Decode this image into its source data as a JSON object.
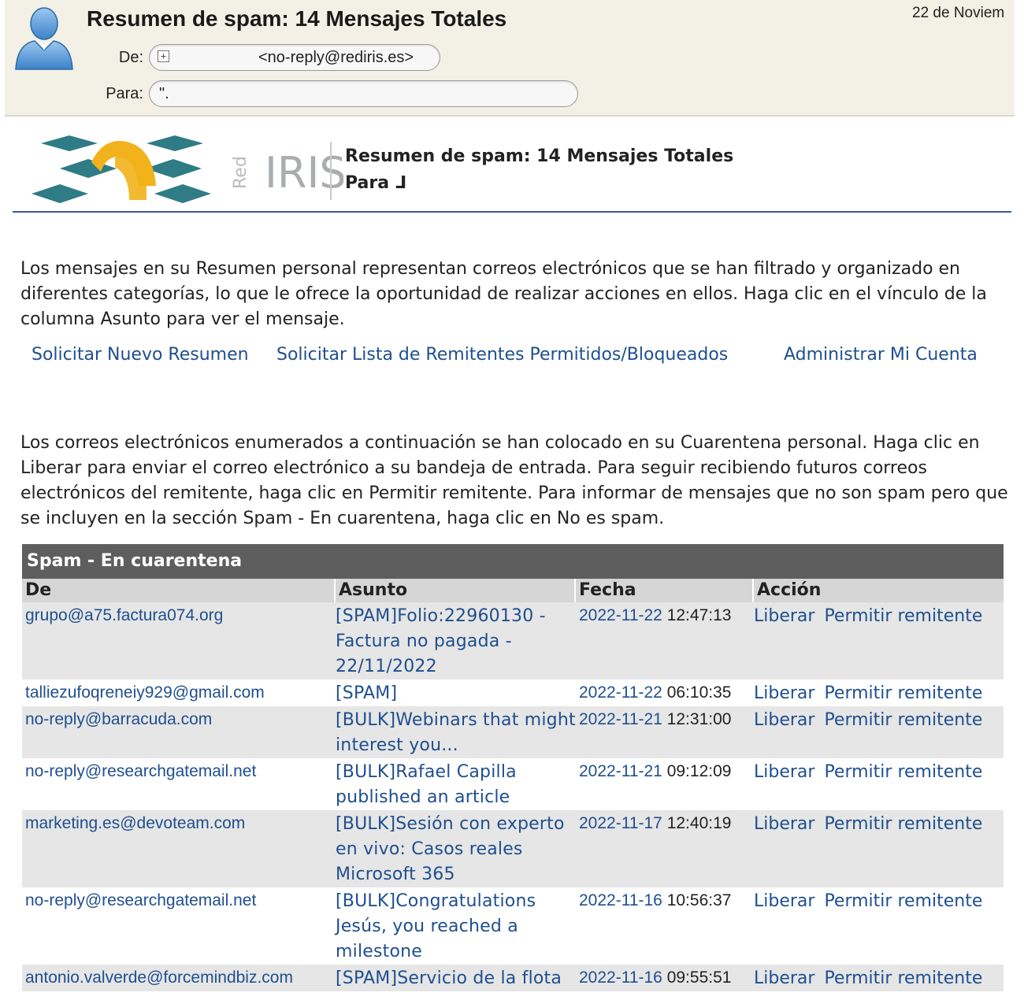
{
  "mail_header": {
    "subject": "Resumen de spam: 14 Mensajes Totales",
    "date": "22 de Noviem",
    "from_label": "De:",
    "from_value": "<no-reply@rediris.es>",
    "to_label": "Para:",
    "to_value": "\"."
  },
  "banner": {
    "logo_text": "IRIS",
    "logo_prefix": "Red",
    "title": "Resumen de spam: 14 Mensajes Totales",
    "para": "Para ⅃"
  },
  "intro": "Los mensajes en su Resumen personal representan correos electrónicos que se han filtrado y organizado en diferentes categorías, lo que le ofrece la oportunidad de realizar acciones en ellos. Haga clic en el vínculo de la columna Asunto para ver el mensaje.",
  "links": {
    "new_summary": "Solicitar Nuevo Resumen",
    "sender_list": "Solicitar Lista de Remitentes Permitidos/Bloqueados",
    "manage_account": "Administrar Mi Cuenta"
  },
  "quarantine_text": "Los correos electrónicos enumerados a continuación se han colocado en su Cuarentena personal. Haga clic en Liberar para enviar el correo electrónico a su bandeja de entrada. Para seguir recibiendo futuros correos electrónicos del remitente, haga clic en Permitir remitente. Para informar de mensajes que no son spam pero que se incluyen en la sección Spam - En cuarentena, haga clic en No es spam.",
  "table": {
    "caption": "Spam - En cuarentena",
    "headers": {
      "de": "De",
      "asunto": "Asunto",
      "fecha": "Fecha",
      "accion": "Acción"
    },
    "release_label": "Liberar",
    "allow_label": "Permitir remitente",
    "rows": [
      {
        "de": "grupo@a75.factura074.org",
        "asunto": " [SPAM]Folio:22960130 - Factura no pagada - 22/11/2022",
        "date": "2022-11-22",
        "time": "12:47:13"
      },
      {
        "de": "talliezufoqreneiy929@gmail.com",
        "asunto": " [SPAM]",
        "date": "2022-11-22",
        "time": "06:10:35"
      },
      {
        "de": "no-reply@barracuda.com",
        "asunto": " [BULK]Webinars that might interest you...",
        "date": "2022-11-21",
        "time": "12:31:00"
      },
      {
        "de": "no-reply@researchgatemail.net",
        "asunto": " [BULK]Rafael Capilla published an article",
        "date": "2022-11-21",
        "time": "09:12:09"
      },
      {
        "de": "marketing.es@devoteam.com",
        "asunto": " [BULK]Sesión con experto en vivo: Casos reales Microsoft 365",
        "date": "2022-11-17",
        "time": "12:40:19"
      },
      {
        "de": "no-reply@researchgatemail.net",
        "asunto": " [BULK]Congratulations Jesús, you reached a milestone",
        "date": "2022-11-16",
        "time": "10:56:37"
      },
      {
        "de": "antonio.valverde@forcemindbiz.com",
        "asunto": "[SPAM]Servicio de la flota",
        "date": "2022-11-16",
        "time": "09:55:51"
      }
    ]
  },
  "colors": {
    "link": "#1f4f8f",
    "caption_bg": "#5e5e5e",
    "header_bg": "#f3f0e6",
    "logo_teal": "#2f7b86",
    "logo_yellow": "#f2b21b"
  }
}
